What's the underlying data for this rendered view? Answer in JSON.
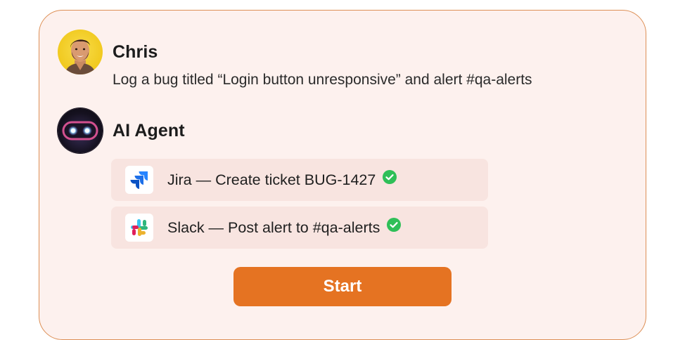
{
  "user": {
    "name": "Chris",
    "message": "Log a bug titled “Login button unresponsive” and alert #qa-alerts"
  },
  "agent": {
    "name": "AI Agent"
  },
  "actions": [
    {
      "app_icon": "jira-icon",
      "text": "Jira — Create ticket BUG-1427",
      "status_icon": "check-circle-icon"
    },
    {
      "app_icon": "slack-icon",
      "text": "Slack — Post alert to #qa-alerts",
      "status_icon": "check-circle-icon"
    }
  ],
  "start_button": {
    "label": "Start"
  },
  "colors": {
    "card_background": "#fdf1ee",
    "card_border": "#dd8f55",
    "action_background": "#f8e4e0",
    "accent": "#e57322",
    "success": "#2fbf58"
  }
}
